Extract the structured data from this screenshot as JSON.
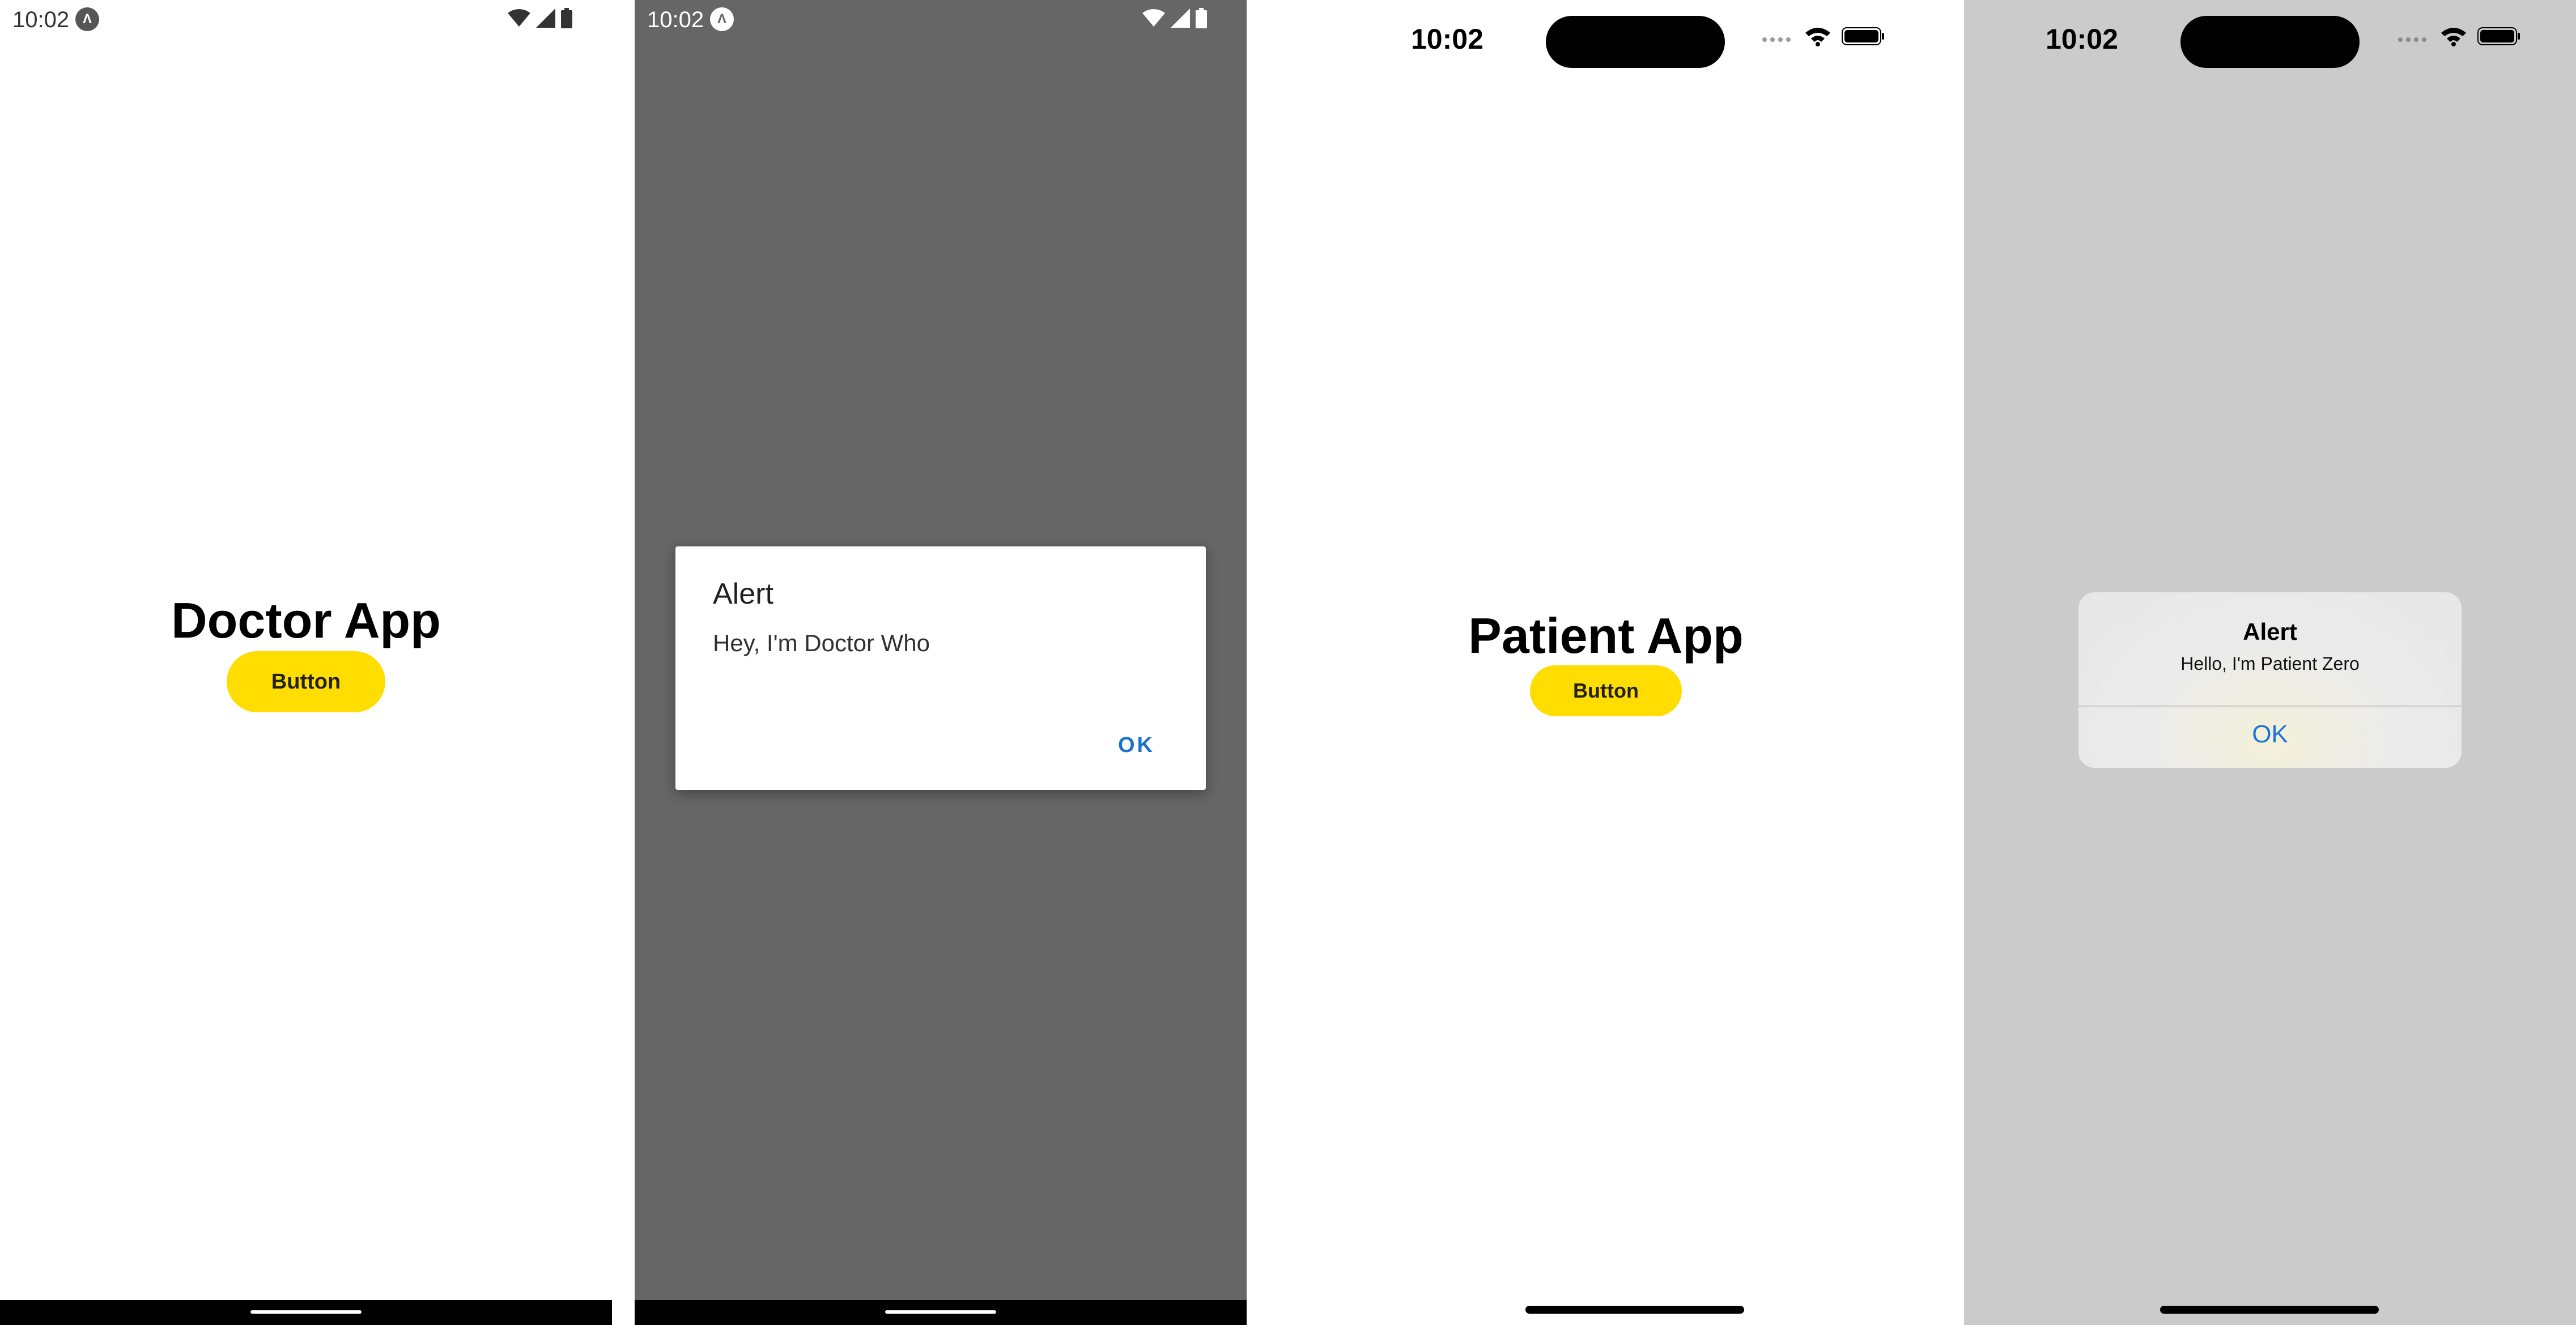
{
  "doctor_screen": {
    "status_time": "10:02",
    "title": "Doctor App",
    "button_label": "Button"
  },
  "doctor_alert_screen": {
    "status_time": "10:02",
    "alert_title": "Alert",
    "alert_message": "Hey, I'm Doctor Who",
    "ok_label": "OK"
  },
  "patient_screen": {
    "status_time": "10:02",
    "title": "Patient App",
    "button_label": "Button"
  },
  "patient_alert_screen": {
    "status_time": "10:02",
    "alert_title": "Alert",
    "alert_message": "Hello, I'm Patient Zero",
    "ok_label": "OK"
  },
  "icons": [
    "expo-icon",
    "wifi-icon",
    "cellular-signal-icon",
    "battery-icon",
    "dynamic-island"
  ],
  "colors": {
    "button_yellow": "#ffdd00",
    "android_accent": "#1a73c9",
    "ios_accent": "#1d74d8",
    "android_scrim": "#666666",
    "ios_scrim": "#cbcbcb"
  }
}
